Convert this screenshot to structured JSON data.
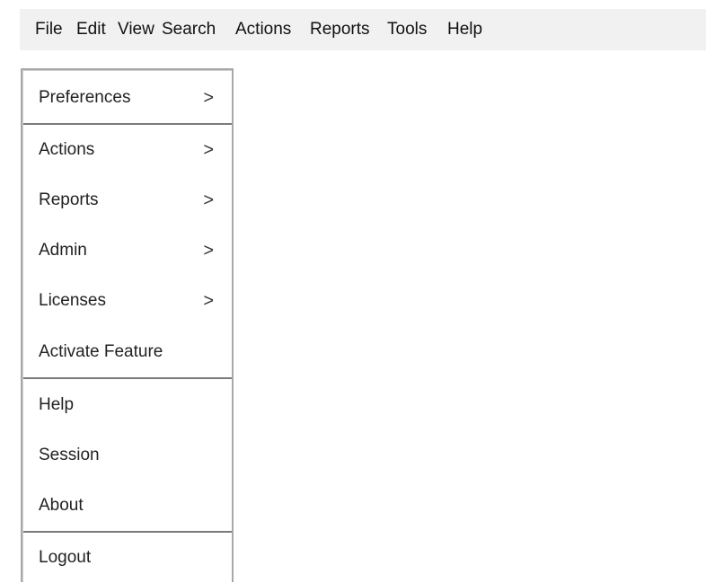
{
  "menubar": {
    "items": [
      "File",
      "Edit",
      "View",
      "Search",
      "Actions",
      "Reports",
      "Tools",
      "Help"
    ]
  },
  "dropdown": {
    "items": [
      {
        "label": "Preferences",
        "submenu": ">"
      },
      {
        "label": "Actions",
        "submenu": ">"
      },
      {
        "label": "Reports",
        "submenu": ">"
      },
      {
        "label": "Admin",
        "submenu": ">"
      },
      {
        "label": "Licenses",
        "submenu": ">"
      },
      {
        "label": "Activate Feature"
      },
      {
        "label": "Help"
      },
      {
        "label": "Session"
      },
      {
        "label": "About"
      },
      {
        "label": "Logout"
      }
    ]
  },
  "colors": {
    "menubar_bg": "#f1f1f1",
    "dropdown_border": "#a8a8a8",
    "separator": "#7a7a7a"
  }
}
